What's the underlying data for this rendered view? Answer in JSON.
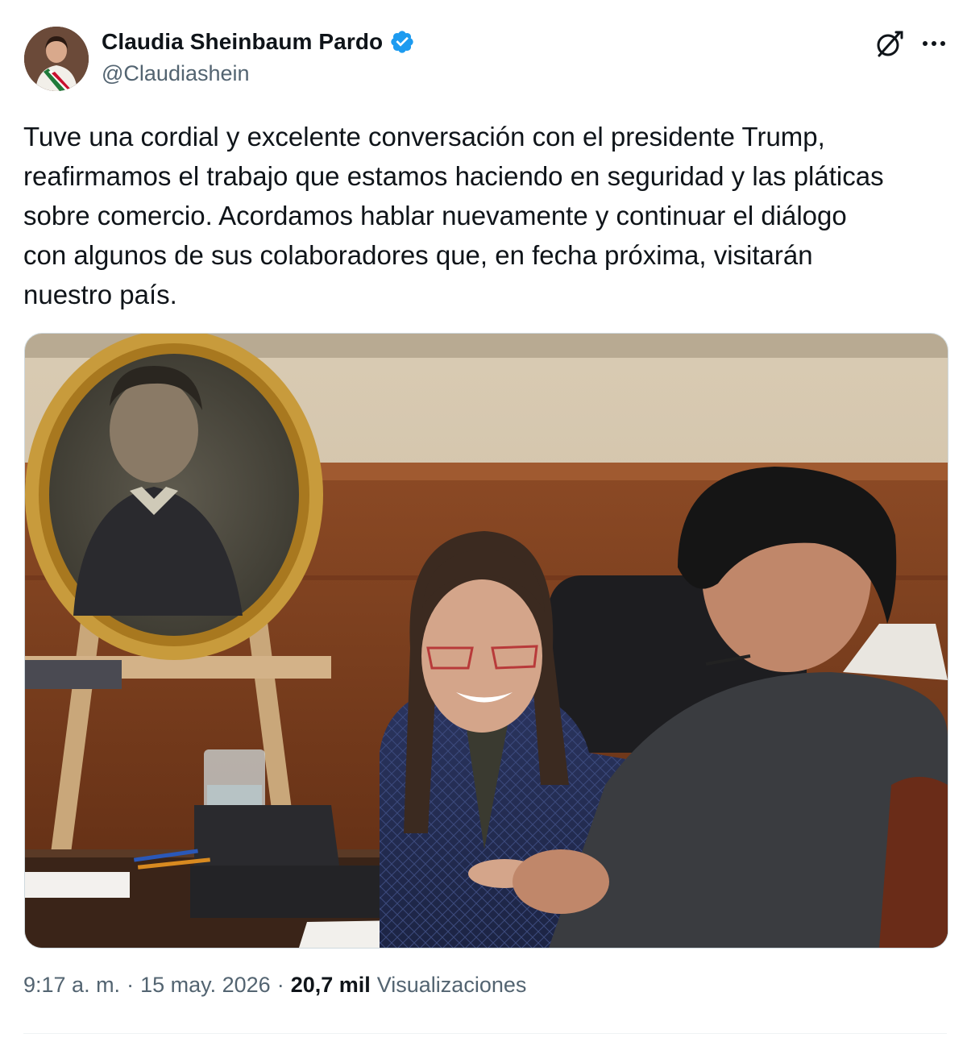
{
  "author": {
    "display_name": "Claudia Sheinbaum Pardo",
    "handle": "@Claudiashein",
    "verified": true,
    "avatar_icon": "profile-photo"
  },
  "header_actions": {
    "grok_icon": "grok-icon",
    "more_icon": "more-options-icon"
  },
  "tweet": {
    "text": "Tuve una cordial y excelente conversación con el presidente Trump,\nreafirmamos el trabajo que estamos haciendo en seguridad y las pláticas\nsobre comercio. Acordamos hablar nuevamente y continuar el diálogo\ncon algunos de sus colaboradores que, en fecha próxima, visitarán\nnuestro país."
  },
  "meta": {
    "time": "9:17 a. m.",
    "date": "15 may. 2026",
    "separator": "·",
    "views_count": "20,7 mil",
    "views_label": "Visualizaciones"
  },
  "colors": {
    "text_primary": "#0f1419",
    "text_secondary": "#536471",
    "verified_blue": "#1d9bf0",
    "border": "#cfd9de"
  }
}
